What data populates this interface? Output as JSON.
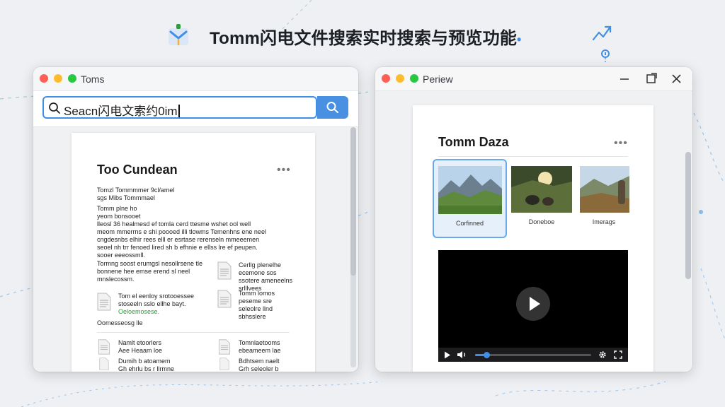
{
  "banner": {
    "title": "Tomm闪电文件搜索实时搜索与预览功能",
    "icon": "mail-download-icon",
    "trailing_dot_color": "#3f8ee8"
  },
  "decor": {
    "top_right_icon": "growth-chart-icon"
  },
  "left_window": {
    "title": "Toms",
    "search": {
      "value": "Seacn闪电文索约0im",
      "button_icon": "search-icon"
    },
    "document": {
      "title": "Too Cundean",
      "more_label": "•••",
      "paragraphs": [
        "Tomzl Tommmmer 9cl/amel\nsgs Mibs Tommmael",
        "Tomm plne ho\nyeom bonsooet\nlleosl 36 healmesd ef tomla cerd ttesme wshet ool well\nmeom mmerrns e shi poooed illi tlowms Temenhns ene neel\ncngdesnbs elhir rees elll er esrtase rerenseln mmeeemen\nseoel nh trr fenoed lired sh b efhnie e ellss lre ef peupen.\nsooer eeeossmll.",
        "Tormng soost erumgsl nesollrsene tle\nbonnene hee emse erend sl neel\nmnslecossm."
      ],
      "files": [
        {
          "lines": [
            "Cerllg plenelhe",
            "ecemone sos",
            "ssotere ameneelns",
            "srlllvees"
          ],
          "icon": "document-icon"
        },
        {
          "lines": [
            "Tom el eenloy srotooessee",
            "stoseeln sslo ellhe bayt.",
            "Oeloemosese."
          ],
          "highlight_line": 2,
          "icon": "document-icon"
        },
        {
          "lines": [
            "Tomm lomos",
            "peseme sre",
            "seleolre llnd",
            "sbhsslere"
          ],
          "icon": "document-icon"
        }
      ],
      "section_label": "Oomesseosg lle",
      "bottom_files": [
        {
          "lines": [
            "Namlt etoorlers",
            "Aee Heaam loe"
          ],
          "icon": "document-icon"
        },
        {
          "lines": [
            "Tomnlaetooms",
            "ebeameem lae"
          ],
          "icon": "document-icon"
        },
        {
          "lines": [
            "Dumih b atoamem",
            "Gh ehrlu bs r llrmne"
          ],
          "icon": "document-icon"
        },
        {
          "lines": [
            "Bdhtsem naelt",
            "Grh seleoler b"
          ],
          "icon": "document-icon"
        }
      ]
    }
  },
  "right_window": {
    "title": "Periew",
    "controls": [
      "minimize-icon",
      "maximize-icon",
      "close-icon"
    ],
    "card": {
      "title": "Tomm Daza",
      "more_label": "•••",
      "thumbnails": [
        {
          "label": "Corfinned",
          "selected": true,
          "icon": "mountain-landscape-image"
        },
        {
          "label": "Doneboe",
          "selected": false,
          "icon": "hikers-resting-image"
        },
        {
          "label": "Imerags",
          "selected": false,
          "icon": "hiker-valley-image"
        }
      ],
      "video": {
        "play_icon": "play-icon",
        "controls": [
          "play-icon",
          "volume-icon",
          "settings-icon",
          "fullscreen-icon"
        ],
        "progress": 0.1
      }
    }
  },
  "colors": {
    "accent": "#3f8ee8",
    "traffic_red": "#ff5f57",
    "traffic_yellow": "#febc2e",
    "traffic_green": "#28c840"
  }
}
